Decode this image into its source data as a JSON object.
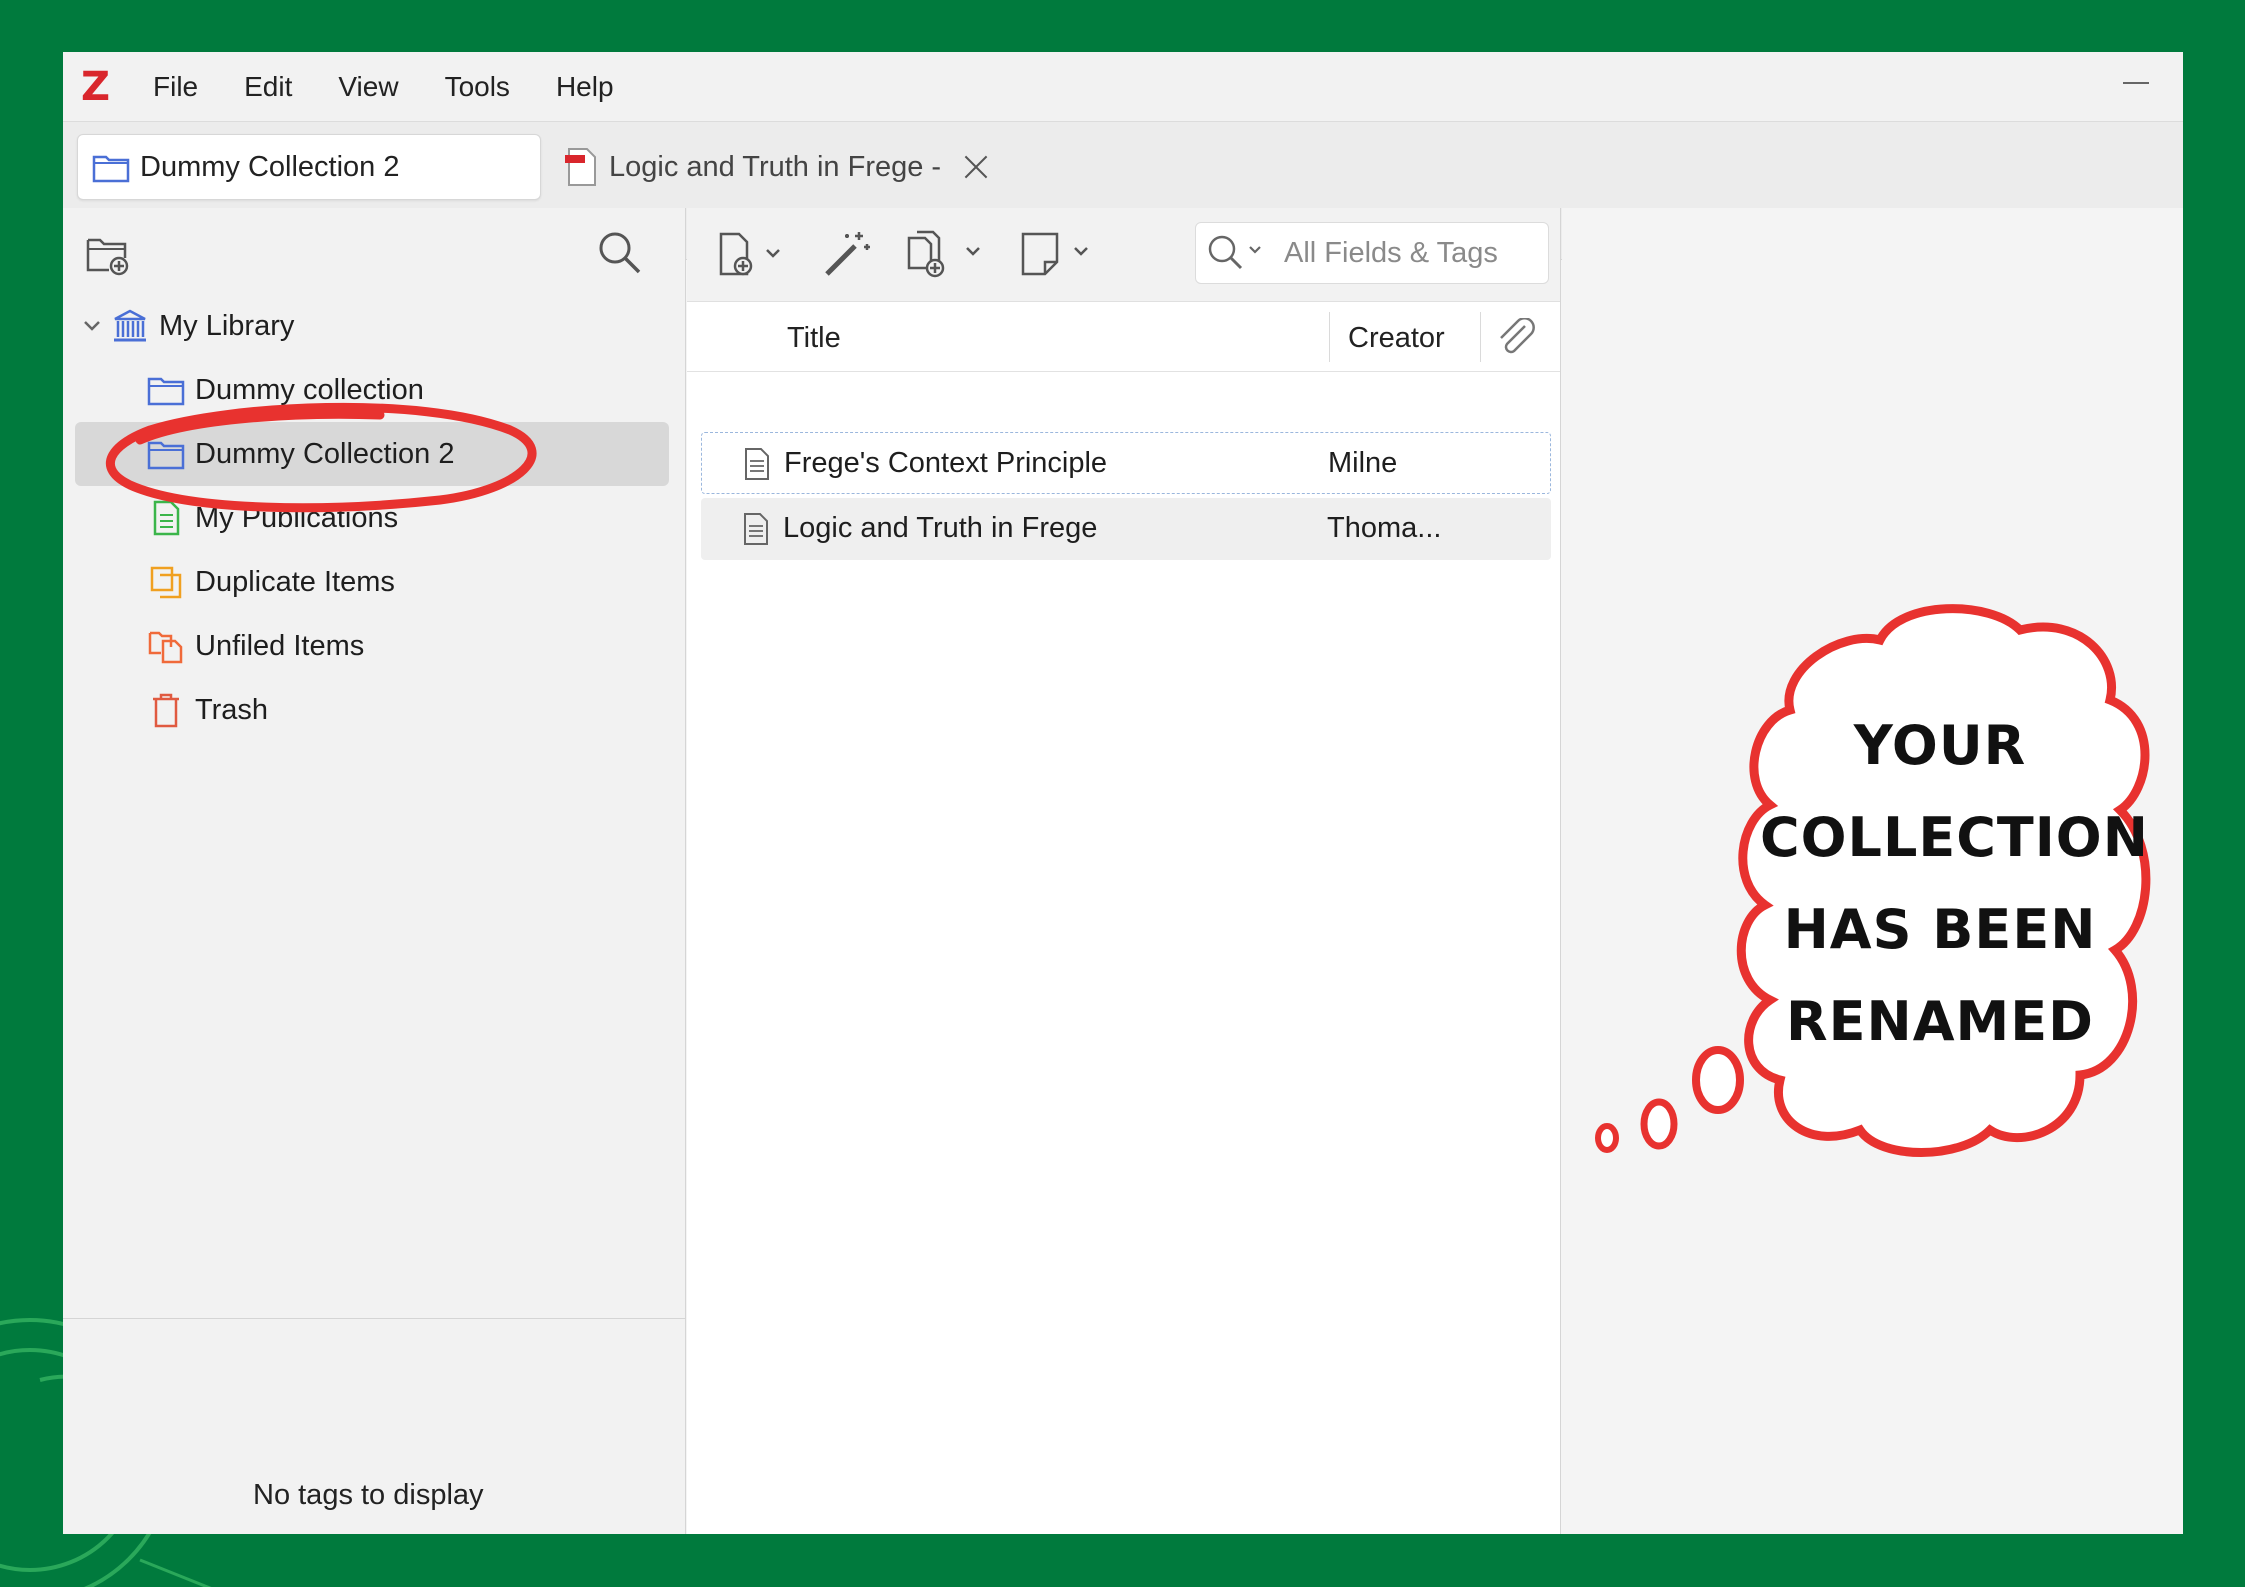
{
  "menubar": {
    "logo": "Z",
    "items": [
      "File",
      "Edit",
      "View",
      "Tools",
      "Help"
    ]
  },
  "tabs": [
    {
      "label": "Dummy Collection 2",
      "icon": "folder-icon"
    },
    {
      "label": "Logic and Truth in Frege -",
      "icon": "pdf-icon"
    }
  ],
  "sidebar": {
    "items": [
      {
        "label": "My Library",
        "icon": "library-icon"
      },
      {
        "label": "Dummy collection",
        "icon": "folder-icon"
      },
      {
        "label": "Dummy Collection 2",
        "icon": "folder-icon"
      },
      {
        "label": "My Publications",
        "icon": "publications-icon"
      },
      {
        "label": "Duplicate Items",
        "icon": "duplicate-icon"
      },
      {
        "label": "Unfiled Items",
        "icon": "unfiled-icon"
      },
      {
        "label": "Trash",
        "icon": "trash-icon"
      }
    ],
    "tags_empty": "No tags to display"
  },
  "items_pane": {
    "search_placeholder": "All Fields & Tags",
    "columns": {
      "title": "Title",
      "creator": "Creator"
    },
    "rows": [
      {
        "title": "Frege's Context Principle",
        "creator": "Milne"
      },
      {
        "title": "Logic and Truth in Frege",
        "creator": "Thoma..."
      }
    ]
  },
  "annotation": {
    "lines": [
      "YOUR",
      "COLLECTION",
      "HAS BEEN",
      "RENAMED"
    ],
    "color": "#e8322f"
  },
  "colors": {
    "background": "#007a3d",
    "accent": "#d9262c",
    "folder": "#4a6fd6"
  }
}
